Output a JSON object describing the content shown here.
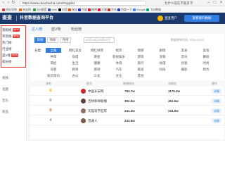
{
  "browser": {
    "url": "https://www.douchacha.com/#/upplist",
    "right_text": "为什么现在不能开学",
    "bookmarks": [
      "网址导航",
      "淘宝网",
      "360搜索",
      "Web",
      "抖音",
      "淘宝",
      "百度",
      "微博",
      "天猫",
      "京东",
      "百度一下",
      "Google",
      "飞瓜数据"
    ]
  },
  "header": {
    "logo": "查查",
    "title": "抖音数据查询平台",
    "user": "查查用户",
    "cta": "查看我的数据",
    "colors": {
      "bg": "#1b3a6b",
      "accent": "#2f7de1"
    }
  },
  "sidebar": {
    "items": [
      {
        "label": "涨粉榜",
        "badge": "NEW"
      },
      {
        "label": "带货榜",
        "badge": "NEW"
      },
      {
        "label": "热门榜",
        "badge": ""
      },
      {
        "label": "行业榜",
        "badge": ""
      },
      {
        "label": "蓝V榜",
        "badge": "NEW"
      },
      {
        "label": "成长榜",
        "badge": ""
      }
    ],
    "extra": [
      "视频",
      "话题",
      "音乐",
      "商品"
    ]
  },
  "category_tabs": [
    "达人榜",
    "蓝V榜",
    "粉丝榜"
  ],
  "periods": [
    "日榜",
    "周榜",
    "月榜"
  ],
  "date_range": "02月24日-03月01日",
  "update_note": "数据更新时间: 2020-03-03",
  "filter_label": "分类:",
  "chips": [
    "全部",
    "网红美女",
    "网红帅哥",
    "搞笑",
    "情感",
    "剧情",
    "美食",
    "美妆",
    "种草",
    "穿搭",
    "明星",
    "影视娱乐",
    "游戏",
    "宠物",
    "音乐",
    "舞蹈",
    "萌娃",
    "生活",
    "健康",
    "体育",
    "旅行",
    "动漫",
    "创意",
    "时尚",
    "母婴",
    "教育",
    "职场",
    "汽车",
    "家居",
    "科技",
    "摄影",
    "政务",
    "知识资讯",
    "办公",
    "三农",
    "文化",
    "其他"
  ],
  "table": {
    "headers": [
      "排名",
      "账号",
      "新增粉丝",
      "总粉丝",
      "操作"
    ],
    "rows": [
      {
        "rank": "1",
        "name": "中国长安网",
        "v1": "793.7w",
        "v2": "1176.2w",
        "btn": "详情"
      },
      {
        "rank": "2",
        "name": "吉林新闻联播",
        "v1": "302.9w",
        "v2": "361.9w",
        "btn": "详情"
      },
      {
        "rank": "3",
        "name": "天猫双节狂欢",
        "v1": "241.3w",
        "v2": "224.8w",
        "btn": "详情"
      },
      {
        "rank": "4",
        "name": "普通人",
        "v1": "233.6w",
        "v2": "",
        "btn": "详情"
      }
    ]
  }
}
